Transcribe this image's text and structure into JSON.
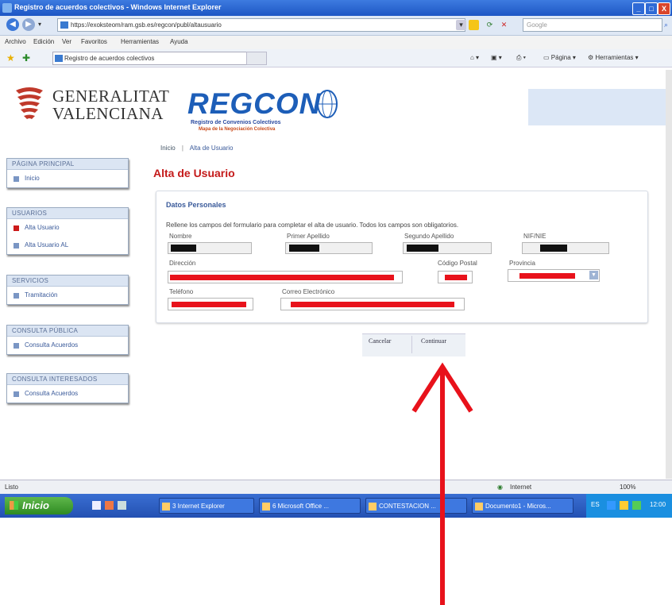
{
  "window": {
    "title": "Registro de acuerdos colectivos - Windows Internet Explorer",
    "buttons": [
      "_",
      "□",
      "X"
    ]
  },
  "address_bar": {
    "url": "https://exoksteom/ram.gsb.es/regcon/publ/altausuario",
    "search_placeholder": "Google"
  },
  "menu": [
    "Archivo",
    "Edición",
    "Ver",
    "Favoritos",
    "Herramientas",
    "Ayuda"
  ],
  "tab": {
    "label": "Registro de acuerdos colectivos",
    "commands": [
      "Página",
      "Herramientas"
    ]
  },
  "header": {
    "gv_line1": "GENERALITAT",
    "gv_line2": "VALENCIANA",
    "regcon": "REGCON",
    "regcon_sub1": "Registro de Convenios Colectivos",
    "regcon_sub2": "Mapa de la Negociación Colectiva"
  },
  "sidebar": {
    "sections": [
      {
        "title": "PÁGINA PRINCIPAL",
        "items": [
          {
            "label": "Inicio",
            "active": false
          }
        ]
      },
      {
        "title": "USUARIOS",
        "items": [
          {
            "label": "Alta Usuario",
            "active": true
          },
          {
            "label": "Alta Usuario AL",
            "active": false
          }
        ]
      },
      {
        "title": "SERVICIOS",
        "items": [
          {
            "label": "Tramitación",
            "active": false
          }
        ]
      },
      {
        "title": "CONSULTA PÚBLICA",
        "items": [
          {
            "label": "Consulta Acuerdos",
            "active": false
          }
        ]
      },
      {
        "title": "CONSULTA INTERESADOS",
        "items": [
          {
            "label": "Consulta Acuerdos",
            "active": false
          }
        ]
      }
    ]
  },
  "breadcrumb": {
    "home": "Inicio",
    "separator": "|",
    "current": "Alta de Usuario"
  },
  "page_title": "Alta de Usuario",
  "form": {
    "section_title": "Datos Personales",
    "description": "Rellene los campos del formulario para completar el alta de usuario. Todos los campos son obligatorios.",
    "labels": {
      "nombre": "Nombre",
      "apellido1": "Primer Apellido",
      "apellido2": "Segundo Apellido",
      "nif": "NIF/NIE",
      "direccion": "Dirección",
      "cp": "Código Postal",
      "provincia": "Provincia",
      "telefono": "Teléfono",
      "email": "Correo Electrónico"
    }
  },
  "buttons": {
    "cancel": "Cancelar",
    "continue": "Continuar"
  },
  "status": {
    "left": "Listo",
    "zone": "Internet",
    "zoom": "100%"
  },
  "taskbar": {
    "start": "Inicio",
    "tasks": [
      "3 Internet Explorer",
      "6 Microsoft Office ...",
      "CONTESTACION ...",
      "Documento1 - Micros..."
    ],
    "tray_lang": "ES",
    "clock": "12:00"
  },
  "colors": {
    "accent_red": "#c41a1a",
    "regcon_blue": "#1d5eb8",
    "redaction_red": "#e8121b",
    "arrow_red": "#e8121b"
  }
}
